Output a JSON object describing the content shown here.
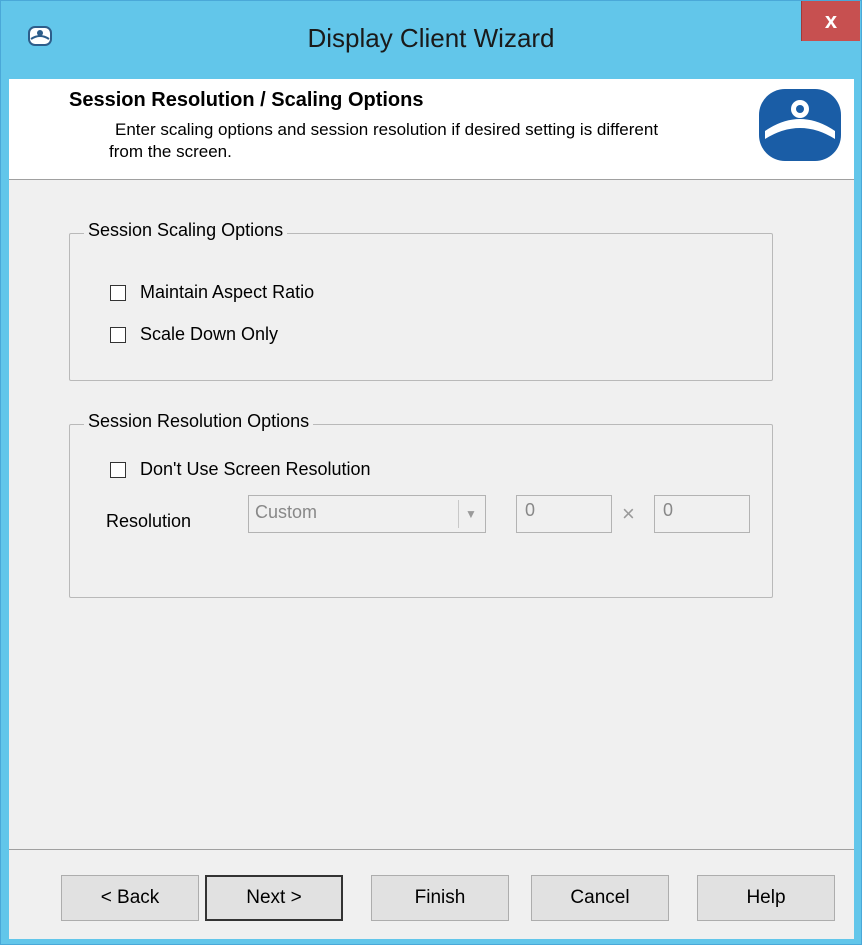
{
  "window": {
    "title": "Display Client Wizard",
    "close_label": "x"
  },
  "header": {
    "title": "Session Resolution / Scaling Options",
    "description": "Enter scaling options and session resolution if desired setting is different from the screen."
  },
  "scaling_group": {
    "legend": "Session Scaling Options",
    "options": [
      {
        "label": "Maintain Aspect Ratio",
        "checked": false
      },
      {
        "label": "Scale Down Only",
        "checked": false
      }
    ]
  },
  "resolution_group": {
    "legend": "Session Resolution Options",
    "dont_use_screen_label": "Don't Use Screen Resolution",
    "dont_use_screen_checked": false,
    "resolution_label": "Resolution",
    "resolution_value": "Custom",
    "width_value": "0",
    "height_value": "0",
    "times_symbol": "×"
  },
  "buttons": {
    "back": "< Back",
    "next": "Next >",
    "finish": "Finish",
    "cancel": "Cancel",
    "help": "Help"
  },
  "colors": {
    "titlebar": "#62c6ea",
    "close": "#c75050",
    "logo_blue": "#1a5da6"
  }
}
